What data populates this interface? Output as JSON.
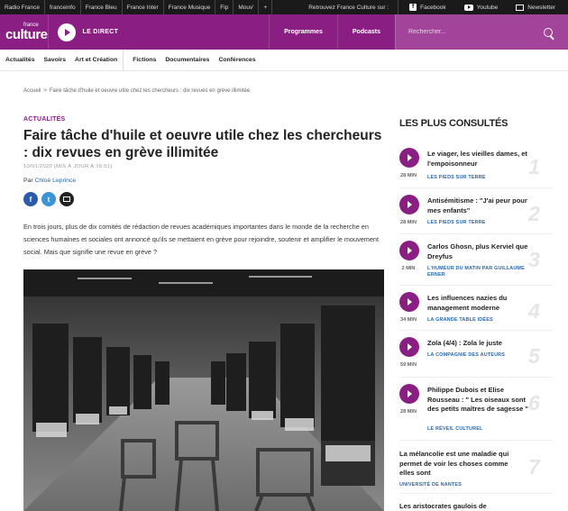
{
  "topbar": {
    "networks": [
      "Radio France",
      "franceinfo",
      "France Bleu",
      "France Inter",
      "France Musique",
      "Fip",
      "Mouv'",
      "+"
    ],
    "retrouvez": "Retrouvez France Culture sur :",
    "facebook": "Facebook",
    "youtube": "Youtube",
    "newsletter": "Newsletter"
  },
  "header": {
    "logo_small": "france",
    "logo_big": "culture",
    "direct_label": "LE DIRECT",
    "programmes": "Programmes",
    "podcasts": "Podcasts",
    "search_placeholder": "Rechercher...",
    "brand_color": "#8b1e82"
  },
  "secnav": {
    "group1": [
      "Actualités",
      "Savoirs",
      "Art et Création"
    ],
    "group2": [
      "Fictions",
      "Documentaires",
      "Conférences"
    ]
  },
  "breadcrumb": {
    "home": "Accueil",
    "separator": ">",
    "current": "Faire tâche d'huile et oeuvre utile chez les chercheurs : dix revues en grève illimitée"
  },
  "article": {
    "category": "ACTUALITÉS",
    "title": "Faire tâche d'huile et oeuvre utile chez les chercheurs : dix revues en grève illimitée",
    "date": "10/01/2020 (MIS À JOUR À 16:51)",
    "author_prefix": "Par",
    "author": "Chloé Leprince",
    "intro": "En trois jours, plus de dix comités de rédaction de revues académiques importantes dans le monde de la recherche en sciences humaines et sociales ont annoncé qu'ils se mettaient en grève pour rejoindre, soutenir et amplifier le mouvement social. Mais que signifie une revue en grève ?"
  },
  "sidebar": {
    "title": "LES PLUS CONSULTÉS",
    "items": [
      {
        "title": "Le viager, les vieilles dames, et l'empoisonneur",
        "show": "LES PIEDS SUR TERRE",
        "duration": "28 MIN",
        "rank": "1"
      },
      {
        "title": "Antisémitisme : \"J'ai peur pour mes enfants\"",
        "show": "LES PIEDS SUR TERRE",
        "duration": "28 MIN",
        "rank": "2"
      },
      {
        "title": "Carlos Ghosn, plus Kerviel que Dreyfus",
        "show": "L'HUMEUR DU MATIN PAR GUILLAUME ERNER",
        "duration": "2 MIN",
        "rank": "3"
      },
      {
        "title": "Les influences nazies du management moderne",
        "show": "LA GRANDE TABLE IDÉES",
        "duration": "34 MIN",
        "rank": "4"
      },
      {
        "title": "Zola (4/4) : Zola le juste",
        "show": "LA COMPAGNIE DES AUTEURS",
        "duration": "59 MIN",
        "rank": "5"
      },
      {
        "title": "Philippe Dubois et Elise Rousseau : \" Les oiseaux sont des petits maîtres de sagesse \"",
        "show": "LE RÉVEIL CULTUREL",
        "duration": "28 MIN",
        "rank": "6"
      },
      {
        "title": "La mélancolie est une maladie qui permet de voir les choses comme elles sont",
        "show": "UNIVERSITÉ DE NANTES",
        "duration": "",
        "rank": "7"
      },
      {
        "title": "Les aristocrates gaulois de",
        "show": "",
        "duration": "",
        "rank": ""
      }
    ]
  }
}
